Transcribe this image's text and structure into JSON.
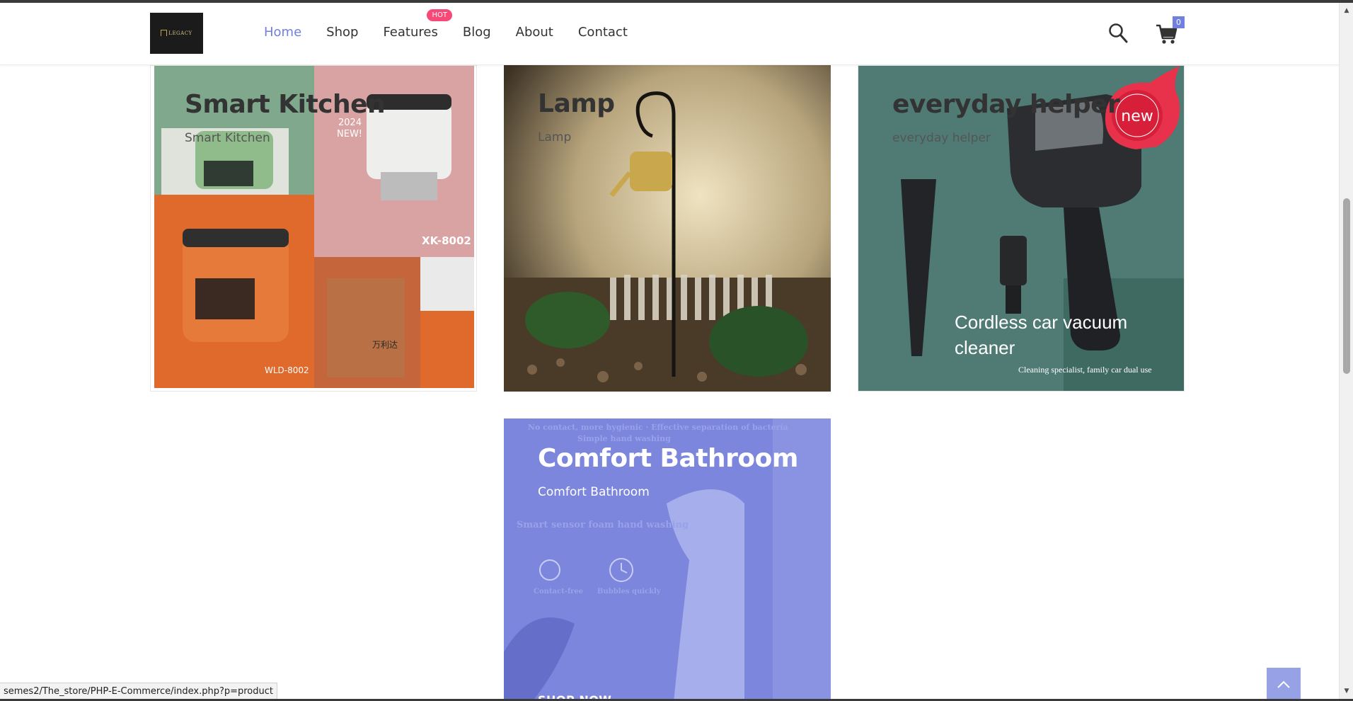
{
  "header": {
    "logo_text": "LEGACY",
    "nav": [
      {
        "label": "Home",
        "active": true
      },
      {
        "label": "Shop",
        "active": false
      },
      {
        "label": "Features",
        "active": false,
        "badge": "HOT"
      },
      {
        "label": "Blog",
        "active": false
      },
      {
        "label": "About",
        "active": false
      },
      {
        "label": "Contact",
        "active": false
      }
    ],
    "cart_count": "0"
  },
  "cards": [
    {
      "title": "Smart Kitchen",
      "subtitle": "Smart Kitchen",
      "image_text": {
        "year": "2024",
        "tag": "NEW!",
        "model_a": "XK-8002",
        "model_b": "WLD-8002",
        "brand": "万利达"
      }
    },
    {
      "title": "Lamp",
      "subtitle": "Lamp"
    },
    {
      "title": "everyday helper",
      "subtitle": "everyday helper",
      "image_text": {
        "badge": "new",
        "headline": "Cordless car vacuum cleaner",
        "tagline": "Cleaning specialist, family car dual use"
      }
    },
    {
      "title": "Comfort Bathroom",
      "subtitle": "Comfort Bathroom",
      "cta": "SHOP NOW",
      "image_text": {
        "line1": "No contact, more hygienic · Effective separation of bacteria",
        "line2": "Simple hand washing",
        "line3": "Smart sensor foam hand washing",
        "feature1": "Contact-free",
        "feature2": "Bubbles quickly"
      }
    }
  ],
  "status_bar": {
    "url": "semes2/The_store/PHP-E-Commerce/index.php?p=product"
  },
  "colors": {
    "accent": "#717fe0",
    "hot_badge": "#f74877"
  }
}
